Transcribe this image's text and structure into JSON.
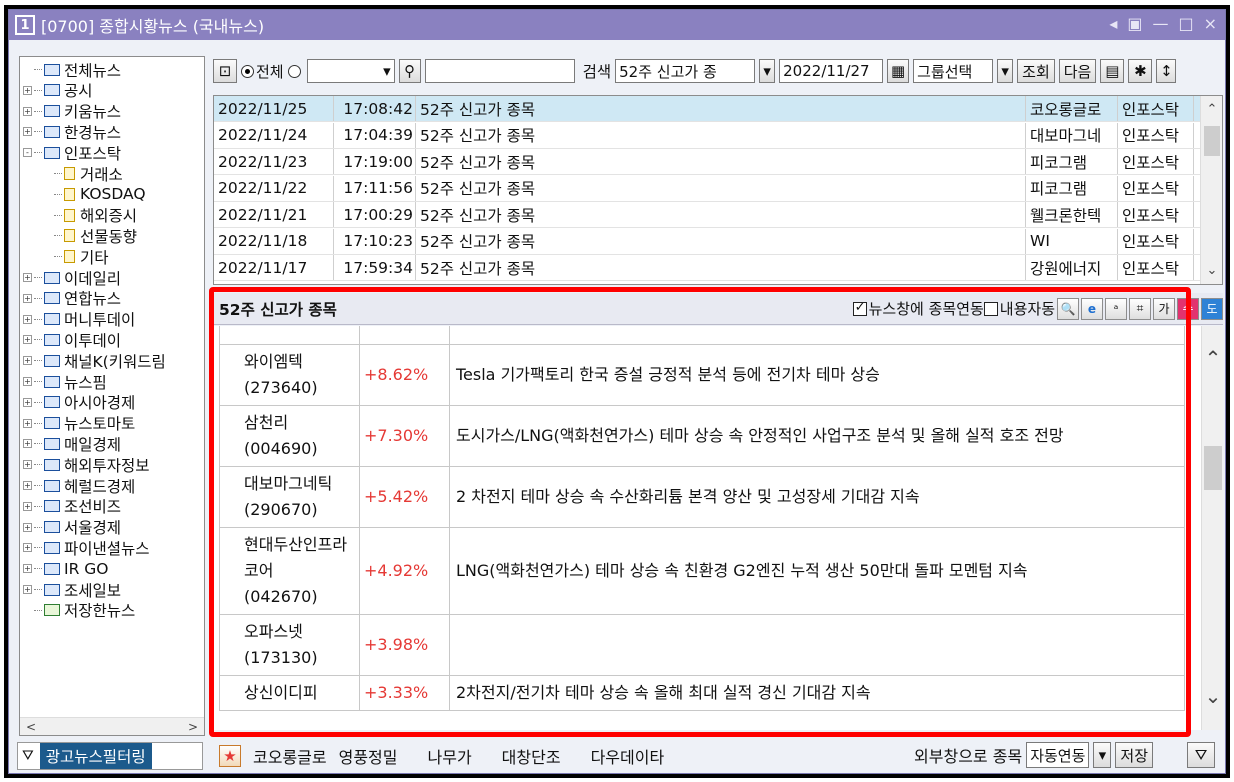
{
  "window": {
    "number": "1",
    "title": "[0700] 종합시황뉴스 (국내뉴스)",
    "controls": [
      "◂",
      "▣",
      "—",
      "□",
      "×"
    ]
  },
  "tree": {
    "items": [
      {
        "label": "전체뉴스",
        "type": "folder",
        "expand": "",
        "indent": 0
      },
      {
        "label": "공시",
        "type": "folder",
        "expand": "+",
        "indent": 0
      },
      {
        "label": "키움뉴스",
        "type": "folder",
        "expand": "+",
        "indent": 0
      },
      {
        "label": "한경뉴스",
        "type": "folder",
        "expand": "+",
        "indent": 0
      },
      {
        "label": "인포스탁",
        "type": "folder",
        "expand": "-",
        "indent": 0
      },
      {
        "label": "거래소",
        "type": "doc",
        "expand": "",
        "indent": 1
      },
      {
        "label": "KOSDAQ",
        "type": "doc",
        "expand": "",
        "indent": 1
      },
      {
        "label": "해외증시",
        "type": "doc",
        "expand": "",
        "indent": 1
      },
      {
        "label": "선물동향",
        "type": "doc",
        "expand": "",
        "indent": 1
      },
      {
        "label": "기타",
        "type": "doc",
        "expand": "",
        "indent": 1
      },
      {
        "label": "이데일리",
        "type": "folder",
        "expand": "+",
        "indent": 0
      },
      {
        "label": "연합뉴스",
        "type": "folder",
        "expand": "+",
        "indent": 0
      },
      {
        "label": "머니투데이",
        "type": "folder",
        "expand": "+",
        "indent": 0
      },
      {
        "label": "이투데이",
        "type": "folder",
        "expand": "+",
        "indent": 0
      },
      {
        "label": "채널K(키워드림",
        "type": "folder",
        "expand": "+",
        "indent": 0
      },
      {
        "label": "뉴스핌",
        "type": "folder",
        "expand": "+",
        "indent": 0
      },
      {
        "label": "아시아경제",
        "type": "folder",
        "expand": "+",
        "indent": 0
      },
      {
        "label": "뉴스토마토",
        "type": "folder",
        "expand": "+",
        "indent": 0
      },
      {
        "label": "매일경제",
        "type": "folder",
        "expand": "+",
        "indent": 0
      },
      {
        "label": "해외투자정보",
        "type": "folder",
        "expand": "+",
        "indent": 0
      },
      {
        "label": "헤럴드경제",
        "type": "folder",
        "expand": "+",
        "indent": 0
      },
      {
        "label": "조선비즈",
        "type": "folder",
        "expand": "+",
        "indent": 0
      },
      {
        "label": "서울경제",
        "type": "folder",
        "expand": "+",
        "indent": 0
      },
      {
        "label": "파이낸셜뉴스",
        "type": "folder",
        "expand": "+",
        "indent": 0
      },
      {
        "label": "IR GO",
        "type": "folder",
        "expand": "+",
        "indent": 0
      },
      {
        "label": "조세일보",
        "type": "folder",
        "expand": "+",
        "indent": 0
      },
      {
        "label": "저장한뉴스",
        "type": "folder-green",
        "expand": "",
        "indent": 0
      }
    ]
  },
  "toolbar": {
    "radio_all": "전체",
    "search_label": "검색",
    "search_value": "52주 신고가 종",
    "date": "2022/11/27",
    "group_select": "그룹선택",
    "query_btn": "조회",
    "next_btn": "다음"
  },
  "news_list": [
    {
      "date": "2022/11/25",
      "time": "17:08:42",
      "title": "52주 신고가 종목",
      "stock": "코오롱글로",
      "source": "인포스탁",
      "selected": true
    },
    {
      "date": "2022/11/24",
      "time": "17:04:39",
      "title": "52주 신고가 종목",
      "stock": "대보마그네",
      "source": "인포스탁",
      "selected": false
    },
    {
      "date": "2022/11/23",
      "time": "17:19:00",
      "title": "52주 신고가 종목",
      "stock": "피코그램",
      "source": "인포스탁",
      "selected": false
    },
    {
      "date": "2022/11/22",
      "time": "17:11:56",
      "title": "52주 신고가 종목",
      "stock": "피코그램",
      "source": "인포스탁",
      "selected": false
    },
    {
      "date": "2022/11/21",
      "time": "17:00:29",
      "title": "52주 신고가 종목",
      "stock": "웰크론한텍",
      "source": "인포스탁",
      "selected": false
    },
    {
      "date": "2022/11/18",
      "time": "17:10:23",
      "title": "52주 신고가 종목",
      "stock": "WI",
      "source": "인포스탁",
      "selected": false
    },
    {
      "date": "2022/11/17",
      "time": "17:59:34",
      "title": "52주 신고가 종목",
      "stock": "강원에너지",
      "source": "인포스탁",
      "selected": false
    }
  ],
  "detail": {
    "title": "52주 신고가 종목",
    "link_check": "뉴스창에 종목연동",
    "auto_check": "내용자동",
    "btn_su": "수",
    "btn_do": "도",
    "rows": [
      {
        "name": "와이엠텍",
        "code": "(273640)",
        "pct": "+8.62%",
        "desc": "Tesla 기가팩토리 한국 증설 긍정적 분석 등에 전기차 테마 상승"
      },
      {
        "name": "삼천리",
        "code": "(004690)",
        "pct": "+7.30%",
        "desc": "도시가스/LNG(액화천연가스) 테마 상승 속 안정적인 사업구조 분석 및 올해 실적 호조 전망"
      },
      {
        "name": "대보마그네틱",
        "code": "(290670)",
        "pct": "+5.42%",
        "desc": "2 차전지 테마 상승 속 수산화리튬 본격 양산 및 고성장세 기대감 지속"
      },
      {
        "name": "현대두산인프라코어",
        "code": "(042670)",
        "pct": "+4.92%",
        "desc": "LNG(액화천연가스) 테마 상승 속 친환경 G2엔진 누적 생산 50만대 돌파 모멘텀 지속"
      },
      {
        "name": "오파스넷",
        "code": "(173130)",
        "pct": "+3.98%",
        "desc": ""
      },
      {
        "name": "상신이디피",
        "code": "",
        "pct": "+3.33%",
        "desc": "2차전지/전기차 테마 상승 속 올해 최대 실적 경신 기대감 지속"
      }
    ]
  },
  "bottom": {
    "filter_label": "광고뉴스필터링",
    "links": [
      "코오롱글로",
      "영풍정밀",
      "나무가",
      "대창단조",
      "다우데이타"
    ],
    "external_label": "외부창으로 종목",
    "auto_link": "자동연동",
    "save_btn": "저장"
  }
}
